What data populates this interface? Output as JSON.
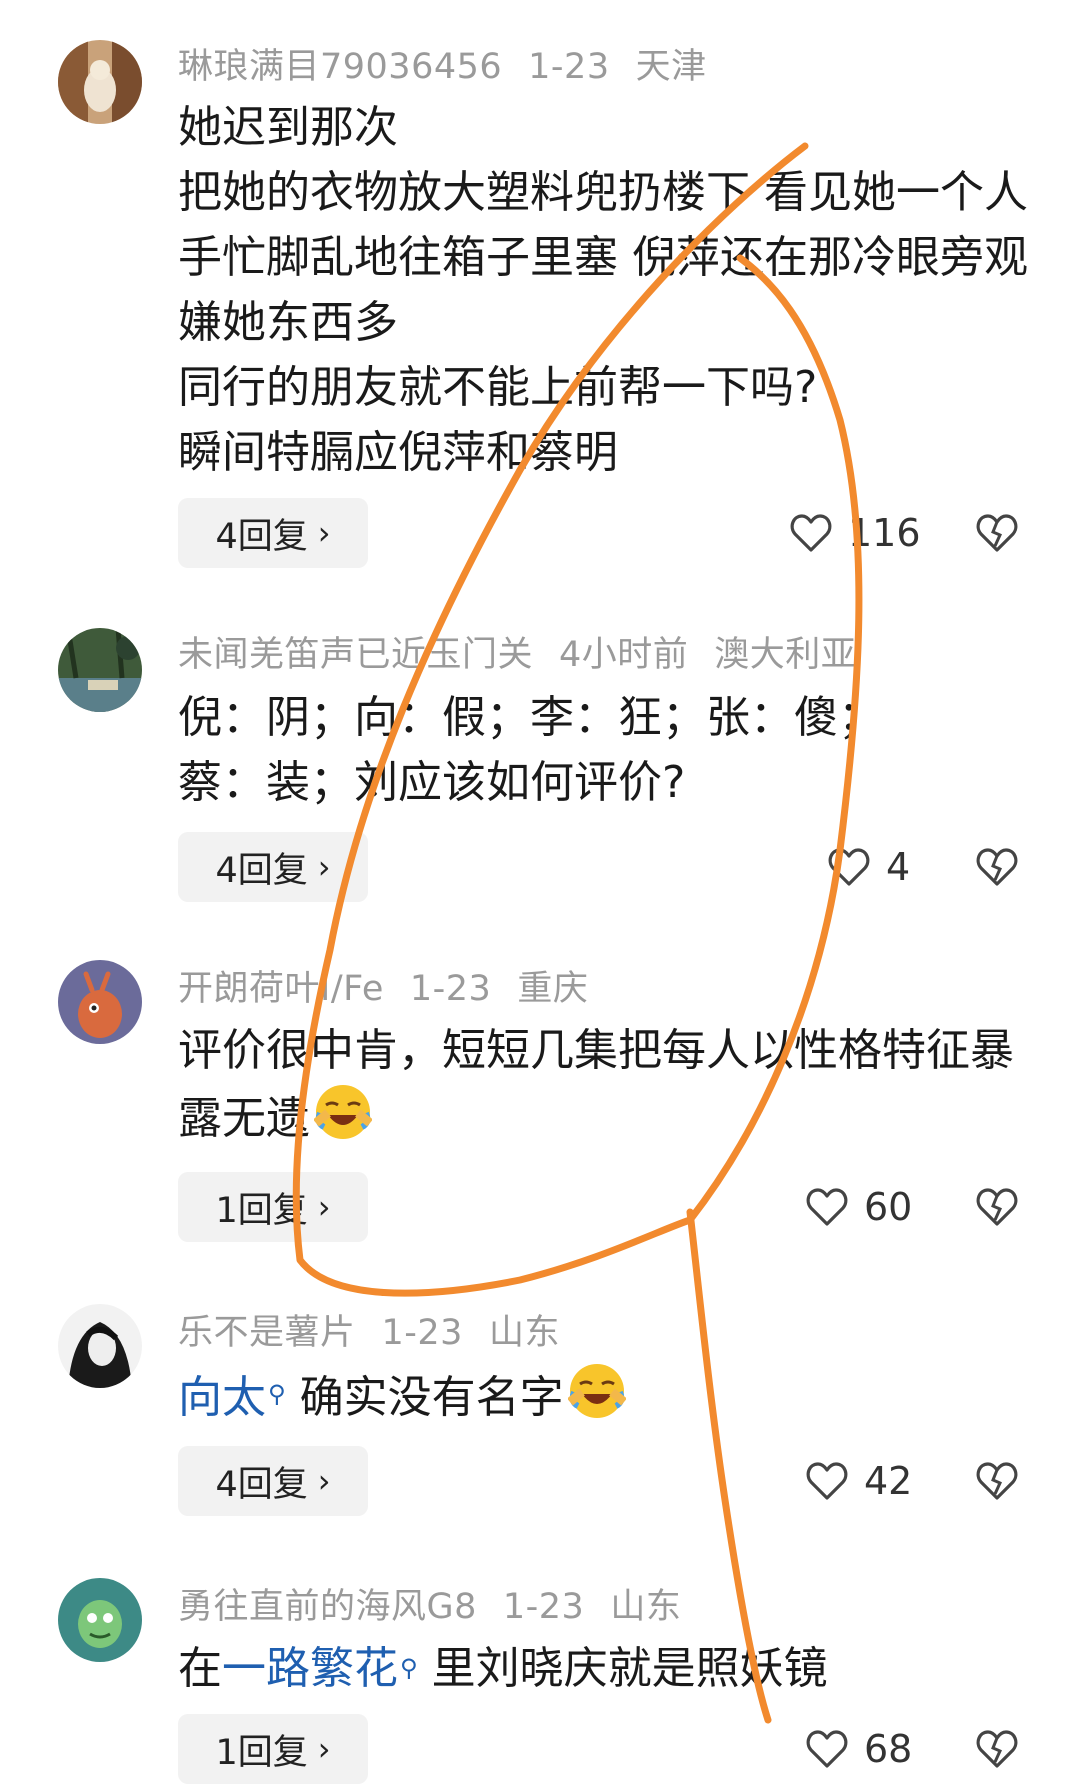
{
  "comments": [
    {
      "user": "琳琅满目79036456",
      "date": "1-23",
      "location": "天津",
      "line1": "她迟到那次",
      "line2": "把她的衣物放大塑料兜扔楼下 看见她一个人手忙脚乱地往箱子里塞 倪萍还在那冷眼旁观 嫌她东西多",
      "line3": "同行的朋友就不能上前帮一下吗?",
      "line4": "瞬间特膈应倪萍和蔡明",
      "replies": "4回复",
      "likes": "116"
    },
    {
      "user": "未闻羌笛声已近玉门关",
      "date": "4小时前",
      "location": "澳大利亚",
      "text": "倪：阴；向：假；李：狂；张：傻；蔡：装；刘应该如何评价?",
      "replies": "4回复",
      "likes": "4"
    },
    {
      "user": "开朗荷叶I/Fe",
      "date": "1-23",
      "location": "重庆",
      "text": "评价很中肯，短短几集把每人以性格特征暴露无遗",
      "replies": "1回复",
      "likes": "60"
    },
    {
      "user": "乐不是薯片",
      "date": "1-23",
      "location": "山东",
      "link": "向太",
      "text": "确实没有名字",
      "replies": "4回复",
      "likes": "42"
    },
    {
      "user": "勇往直前的海风G8",
      "date": "1-23",
      "location": "山东",
      "prefix": "在",
      "link": "一路繁花",
      "text": "里刘晓庆就是照妖镜",
      "replies": "1回复",
      "likes": "68"
    }
  ],
  "icons": {
    "like": "heart-outline-icon",
    "dislike": "broken-heart-icon",
    "search": "search-icon",
    "chevron": "chevron-right-icon"
  },
  "colors": {
    "accent_link": "#1f5fb0",
    "meta": "#9a9a9a",
    "annotation": "#f28a2e"
  }
}
